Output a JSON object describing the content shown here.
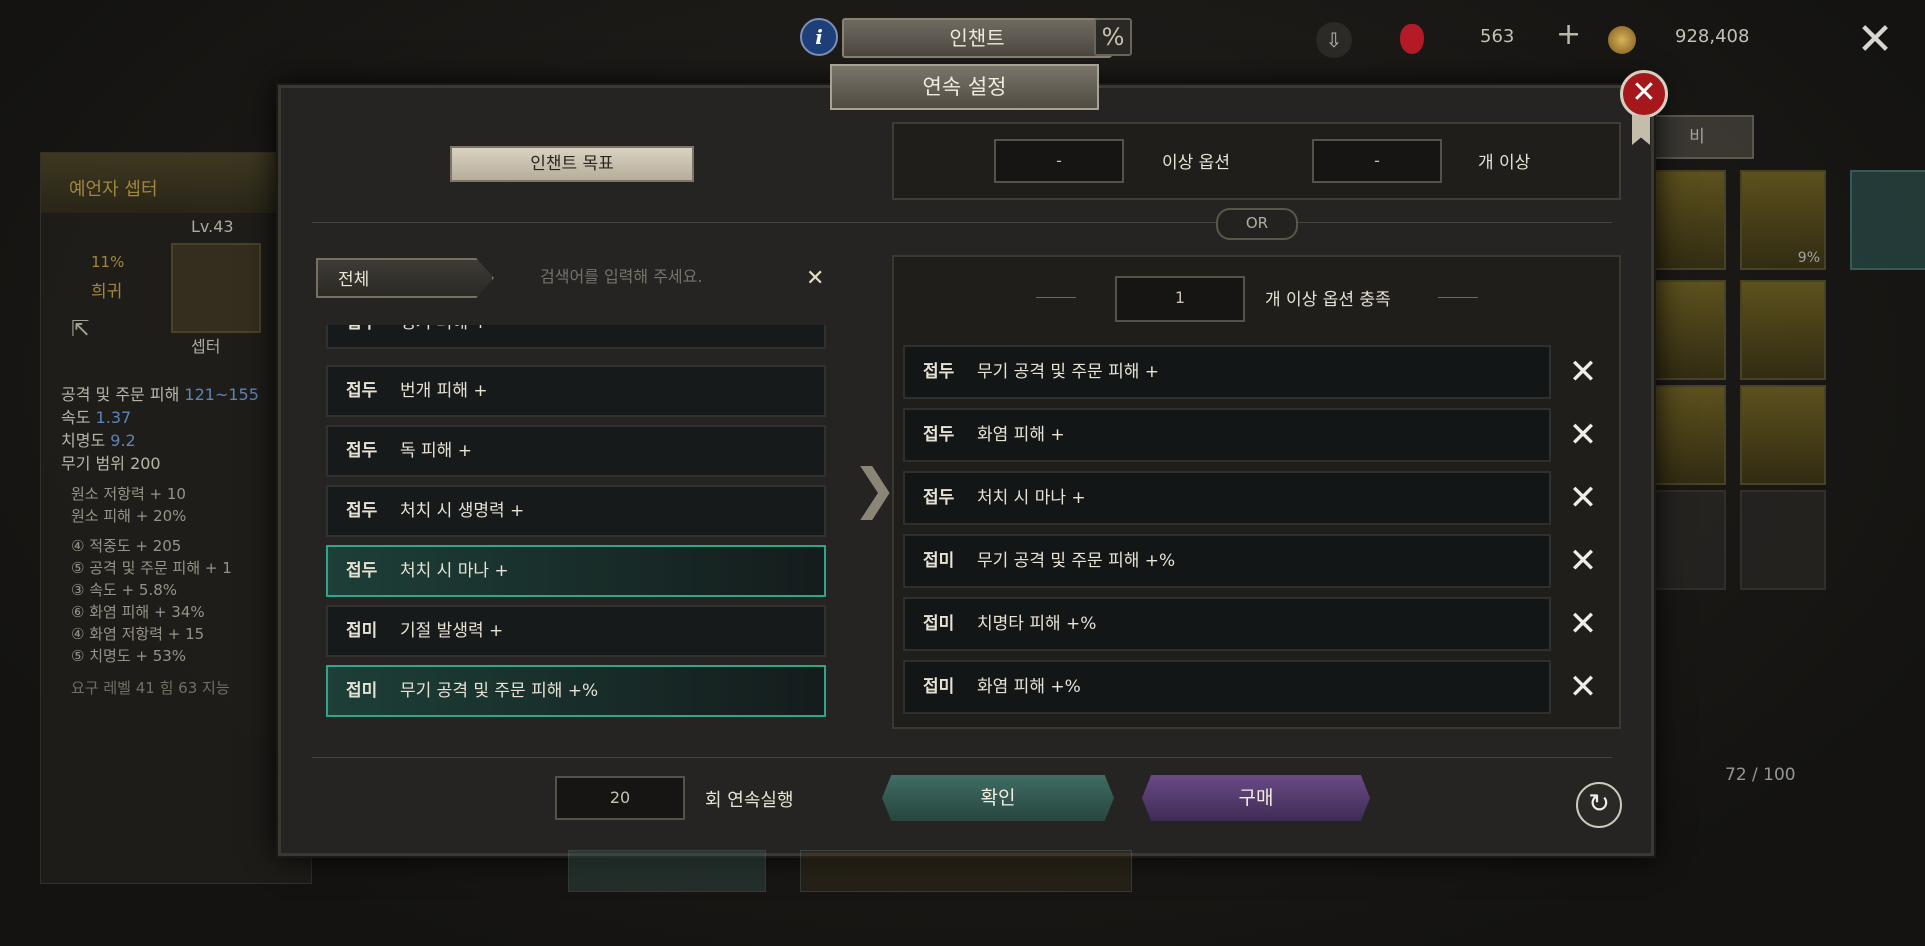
{
  "hud": {
    "title": "인챈트",
    "info_icon": "i",
    "percent_icon": "%",
    "gems": "563",
    "gold": "928,408",
    "close_glyph": "✕"
  },
  "left_panel": {
    "item_name": "예언자 셉터",
    "level": "Lv.43",
    "rarity_pct": "11%",
    "rarity": "희귀",
    "type": "셉터",
    "stats": [
      {
        "label": "공격 및 주문 피해",
        "value": "121~155"
      },
      {
        "label": "속도",
        "value": "1.37"
      },
      {
        "label": "치명도",
        "value": "9.2"
      },
      {
        "label": "무기 범위",
        "value": "200"
      }
    ],
    "bonus": [
      "원소 저항력 + 10",
      "원소 피해 + 20%"
    ],
    "enchants": [
      "④ 적중도 + 205",
      "⑤ 공격 및 주문 피해 + 1",
      "③ 속도 + 5.8%",
      "⑥ 화염 피해 + 34%",
      "④ 화염 저항력 + 15",
      "⑤ 치명도 + 53%"
    ],
    "requirement": "요구 레벨 41 힘 63 지능"
  },
  "right_panel": {
    "slot_pct": "9%",
    "capacity": "72 / 100",
    "title_fragment": "비"
  },
  "modal": {
    "title": "연속 설정",
    "target_label": "인챈트 목표",
    "top_filter": {
      "option_count_value": "-",
      "option_label": "이상 옵션",
      "min_count_value": "-",
      "min_count_label": "개 이상"
    },
    "or_label": "OR",
    "tab_all": "전체",
    "search_placeholder": "검색어를 입력해 주세요.",
    "search_clear": "✕",
    "available_options": [
      {
        "prefix": "접두",
        "text": "냉기 피해 +",
        "selected": false
      },
      {
        "prefix": "접두",
        "text": "번개 피해 +",
        "selected": false
      },
      {
        "prefix": "접두",
        "text": "독 피해 +",
        "selected": false
      },
      {
        "prefix": "접두",
        "text": "처치 시 생명력 +",
        "selected": false
      },
      {
        "prefix": "접두",
        "text": "처치 시 마나 +",
        "selected": true
      },
      {
        "prefix": "접미",
        "text": "기절 발생력 +",
        "selected": false
      },
      {
        "prefix": "접미",
        "text": "무기 공격 및 주문 피해 +%",
        "selected": true
      }
    ],
    "transfer_arrow": "❯",
    "satisfy_count": "1",
    "satisfy_label": "개 이상 옵션 충족",
    "chosen_options": [
      {
        "prefix": "접두",
        "text": "무기 공격 및 주문 피해 +"
      },
      {
        "prefix": "접두",
        "text": "화염 피해 +"
      },
      {
        "prefix": "접두",
        "text": "처치 시 마나 +"
      },
      {
        "prefix": "접미",
        "text": "무기 공격 및 주문 피해 +%"
      },
      {
        "prefix": "접미",
        "text": "치명타 피해 +%"
      },
      {
        "prefix": "접미",
        "text": "화염 피해 +%"
      }
    ],
    "remove_glyph": "✕",
    "repeat_count": "20",
    "repeat_label": "회 연속실행",
    "confirm_label": "확인",
    "buy_label": "구매",
    "refresh_glyph": "↻",
    "close_glyph": "✕"
  },
  "colors": {
    "selected_border": "#2fa58a",
    "confirm_button": "#3f6d64",
    "buy_button": "#6a4a86",
    "close_red": "#a4171b",
    "rarity_gold": "#c8a548"
  },
  "icons": [
    "info-icon",
    "percent-icon",
    "download-icon",
    "ruby-icon",
    "plus-icon",
    "gold-coin-icon",
    "close-icon",
    "remove-icon",
    "refresh-icon",
    "chevron-right-icon",
    "share-icon"
  ]
}
